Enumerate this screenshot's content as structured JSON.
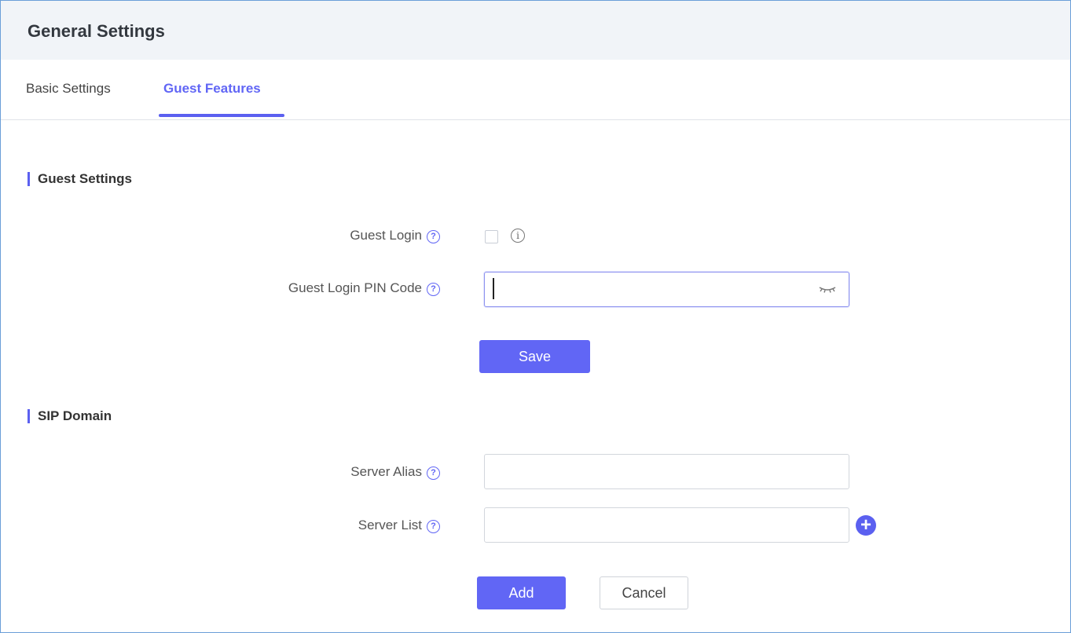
{
  "header": {
    "title": "General Settings"
  },
  "tabs": [
    {
      "label": "Basic Settings",
      "active": false
    },
    {
      "label": "Guest Features",
      "active": true
    }
  ],
  "guest_settings": {
    "title": "Guest Settings",
    "guest_login": {
      "label": "Guest Login",
      "checked": false
    },
    "pin_code": {
      "label": "Guest Login PIN Code",
      "value": "",
      "placeholder": ""
    },
    "save_label": "Save"
  },
  "sip_domain": {
    "title": "SIP Domain",
    "server_alias": {
      "label": "Server Alias",
      "value": ""
    },
    "server_list": {
      "label": "Server List",
      "value": ""
    },
    "add_label": "Add",
    "cancel_label": "Cancel"
  },
  "icons": {
    "help": "help-circle-icon",
    "info": "info-circle-icon",
    "eye": "eye-closed-icon",
    "plus": "plus-circle-icon"
  },
  "colors": {
    "accent": "#6166f5",
    "header_bg": "#f1f4f8",
    "frame_border": "#6a9ed8"
  }
}
